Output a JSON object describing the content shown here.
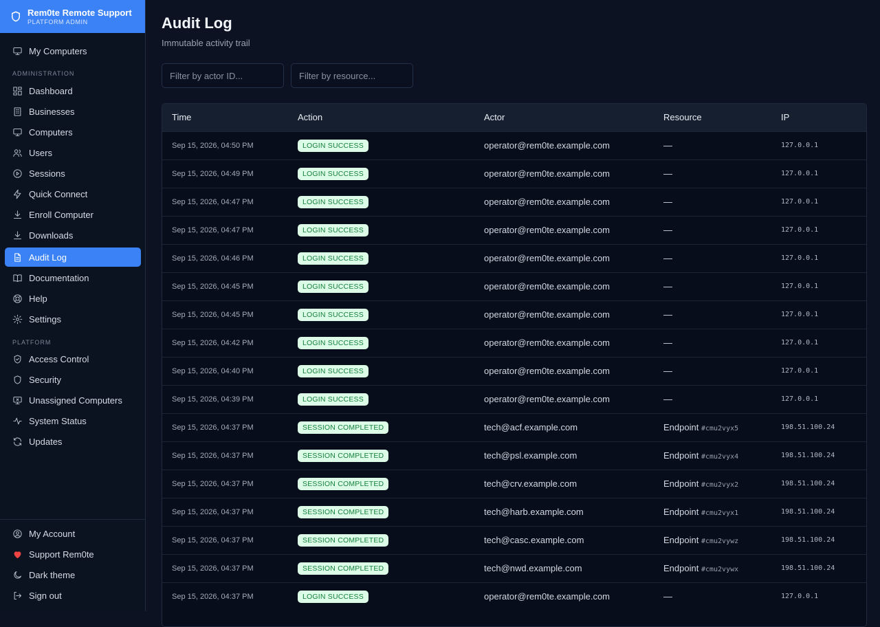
{
  "app": {
    "name": "Rem0te Remote Support",
    "role": "PLATFORM ADMIN",
    "accent": "#3b82f6"
  },
  "sidebar": {
    "top_item": {
      "label": "My Computers",
      "icon": "monitor-icon"
    },
    "admin_label": "ADMINISTRATION",
    "admin_items": [
      {
        "label": "Dashboard",
        "icon": "dashboard-icon"
      },
      {
        "label": "Businesses",
        "icon": "building-icon"
      },
      {
        "label": "Computers",
        "icon": "monitor-icon"
      },
      {
        "label": "Users",
        "icon": "users-icon"
      },
      {
        "label": "Sessions",
        "icon": "play-circle-icon"
      },
      {
        "label": "Quick Connect",
        "icon": "lightning-icon"
      },
      {
        "label": "Enroll Computer",
        "icon": "download-icon"
      },
      {
        "label": "Downloads",
        "icon": "download-icon"
      },
      {
        "label": "Audit Log",
        "icon": "document-icon",
        "active": true
      },
      {
        "label": "Documentation",
        "icon": "book-icon"
      },
      {
        "label": "Help",
        "icon": "lifebuoy-icon"
      },
      {
        "label": "Settings",
        "icon": "gear-icon"
      }
    ],
    "platform_label": "PLATFORM",
    "platform_items": [
      {
        "label": "Access Control",
        "icon": "shield-check-icon"
      },
      {
        "label": "Security",
        "icon": "shield-icon"
      },
      {
        "label": "Unassigned Computers",
        "icon": "monitor-x-icon"
      },
      {
        "label": "System Status",
        "icon": "activity-icon"
      },
      {
        "label": "Updates",
        "icon": "refresh-icon"
      }
    ],
    "bottom_items": [
      {
        "label": "My Account",
        "icon": "user-circle-icon"
      },
      {
        "label": "Support Rem0te",
        "icon": "heart-icon"
      },
      {
        "label": "Dark theme",
        "icon": "moon-icon"
      },
      {
        "label": "Sign out",
        "icon": "logout-icon"
      }
    ]
  },
  "page": {
    "title": "Audit Log",
    "subtitle": "Immutable activity trail"
  },
  "filters": {
    "actor_placeholder": "Filter by actor ID...",
    "resource_placeholder": "Filter by resource..."
  },
  "table": {
    "columns": [
      "Time",
      "Action",
      "Actor",
      "Resource",
      "IP"
    ],
    "rows": [
      {
        "time": "Sep 15, 2026, 04:50 PM",
        "action": "LOGIN SUCCESS",
        "actor": "operator@rem0te.example.com",
        "resource": "—",
        "resource_id": "",
        "ip": "127.0.0.1"
      },
      {
        "time": "Sep 15, 2026, 04:49 PM",
        "action": "LOGIN SUCCESS",
        "actor": "operator@rem0te.example.com",
        "resource": "—",
        "resource_id": "",
        "ip": "127.0.0.1"
      },
      {
        "time": "Sep 15, 2026, 04:47 PM",
        "action": "LOGIN SUCCESS",
        "actor": "operator@rem0te.example.com",
        "resource": "—",
        "resource_id": "",
        "ip": "127.0.0.1"
      },
      {
        "time": "Sep 15, 2026, 04:47 PM",
        "action": "LOGIN SUCCESS",
        "actor": "operator@rem0te.example.com",
        "resource": "—",
        "resource_id": "",
        "ip": "127.0.0.1"
      },
      {
        "time": "Sep 15, 2026, 04:46 PM",
        "action": "LOGIN SUCCESS",
        "actor": "operator@rem0te.example.com",
        "resource": "—",
        "resource_id": "",
        "ip": "127.0.0.1"
      },
      {
        "time": "Sep 15, 2026, 04:45 PM",
        "action": "LOGIN SUCCESS",
        "actor": "operator@rem0te.example.com",
        "resource": "—",
        "resource_id": "",
        "ip": "127.0.0.1"
      },
      {
        "time": "Sep 15, 2026, 04:45 PM",
        "action": "LOGIN SUCCESS",
        "actor": "operator@rem0te.example.com",
        "resource": "—",
        "resource_id": "",
        "ip": "127.0.0.1"
      },
      {
        "time": "Sep 15, 2026, 04:42 PM",
        "action": "LOGIN SUCCESS",
        "actor": "operator@rem0te.example.com",
        "resource": "—",
        "resource_id": "",
        "ip": "127.0.0.1"
      },
      {
        "time": "Sep 15, 2026, 04:40 PM",
        "action": "LOGIN SUCCESS",
        "actor": "operator@rem0te.example.com",
        "resource": "—",
        "resource_id": "",
        "ip": "127.0.0.1"
      },
      {
        "time": "Sep 15, 2026, 04:39 PM",
        "action": "LOGIN SUCCESS",
        "actor": "operator@rem0te.example.com",
        "resource": "—",
        "resource_id": "",
        "ip": "127.0.0.1"
      },
      {
        "time": "Sep 15, 2026, 04:37 PM",
        "action": "SESSION COMPLETED",
        "actor": "tech@acf.example.com",
        "resource": "Endpoint",
        "resource_id": "#cmu2vyx5",
        "ip": "198.51.100.24"
      },
      {
        "time": "Sep 15, 2026, 04:37 PM",
        "action": "SESSION COMPLETED",
        "actor": "tech@psl.example.com",
        "resource": "Endpoint",
        "resource_id": "#cmu2vyx4",
        "ip": "198.51.100.24"
      },
      {
        "time": "Sep 15, 2026, 04:37 PM",
        "action": "SESSION COMPLETED",
        "actor": "tech@crv.example.com",
        "resource": "Endpoint",
        "resource_id": "#cmu2vyx2",
        "ip": "198.51.100.24"
      },
      {
        "time": "Sep 15, 2026, 04:37 PM",
        "action": "SESSION COMPLETED",
        "actor": "tech@harb.example.com",
        "resource": "Endpoint",
        "resource_id": "#cmu2vyx1",
        "ip": "198.51.100.24"
      },
      {
        "time": "Sep 15, 2026, 04:37 PM",
        "action": "SESSION COMPLETED",
        "actor": "tech@casc.example.com",
        "resource": "Endpoint",
        "resource_id": "#cmu2vywz",
        "ip": "198.51.100.24"
      },
      {
        "time": "Sep 15, 2026, 04:37 PM",
        "action": "SESSION COMPLETED",
        "actor": "tech@nwd.example.com",
        "resource": "Endpoint",
        "resource_id": "#cmu2vywx",
        "ip": "198.51.100.24"
      },
      {
        "time": "Sep 15, 2026, 04:37 PM",
        "action": "LOGIN SUCCESS",
        "actor": "operator@rem0te.example.com",
        "resource": "—",
        "resource_id": "",
        "ip": "127.0.0.1"
      }
    ]
  }
}
